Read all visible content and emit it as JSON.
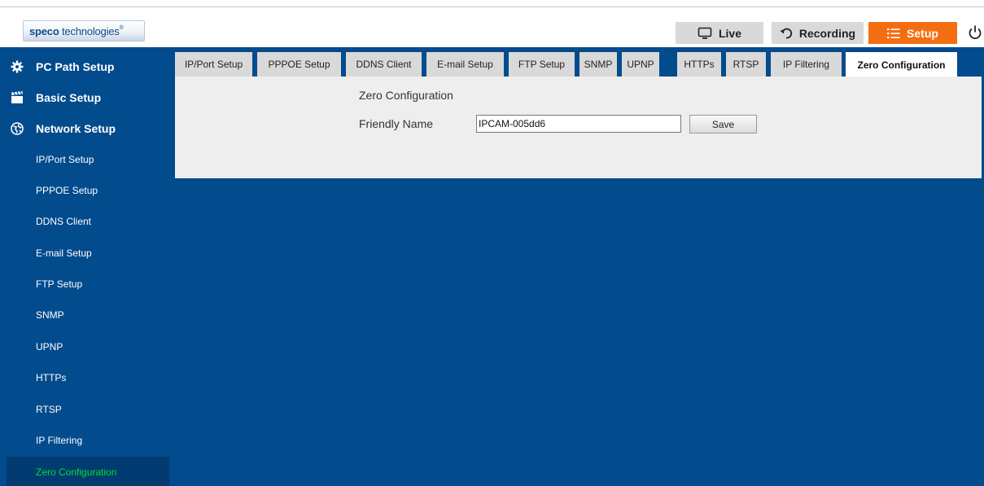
{
  "header": {
    "logo_bold": "speco",
    "logo_rest": " technologies",
    "logo_reg": "®",
    "live_label": "Live",
    "recording_label": "Recording",
    "setup_label": "Setup"
  },
  "colors": {
    "main_blue": "#024b8d",
    "active_item_bg": "#023a72",
    "active_item_text": "#00e02a",
    "setup_orange": "#f36e12",
    "button_grey": "#d9d9d9",
    "panel_grey": "#eeeeee"
  },
  "icons": {
    "live": "monitor-icon",
    "recording": "undo-arrow-icon",
    "setup": "list-icon",
    "power": "power-icon",
    "pc_path": "gear-icon",
    "basic": "clapperboard-icon",
    "network": "globe-icon"
  },
  "sidebar": {
    "sections": [
      {
        "label": "PC Path Setup"
      },
      {
        "label": "Basic Setup"
      },
      {
        "label": "Network Setup"
      }
    ],
    "items": [
      {
        "label": "IP/Port Setup"
      },
      {
        "label": "PPPOE Setup"
      },
      {
        "label": "DDNS Client"
      },
      {
        "label": "E-mail Setup"
      },
      {
        "label": "FTP Setup"
      },
      {
        "label": "SNMP"
      },
      {
        "label": "UPNP"
      },
      {
        "label": "HTTPs"
      },
      {
        "label": "RTSP"
      },
      {
        "label": "IP Filtering"
      },
      {
        "label": "Zero Configuration",
        "active": true
      }
    ]
  },
  "tabs": [
    {
      "label": "IP/Port Setup"
    },
    {
      "label": "PPPOE Setup"
    },
    {
      "label": "DDNS Client"
    },
    {
      "label": "E-mail Setup"
    },
    {
      "label": "FTP Setup"
    },
    {
      "label": "SNMP"
    },
    {
      "label": "UPNP"
    },
    {
      "label": "HTTPs"
    },
    {
      "label": "RTSP"
    },
    {
      "label": "IP Filtering"
    },
    {
      "label": "Zero Configuration",
      "active": true
    }
  ],
  "panel": {
    "title": "Zero Configuration",
    "friendly_name_label": "Friendly Name",
    "friendly_name_value": "IPCAM-005dd6",
    "save_label": "Save"
  }
}
